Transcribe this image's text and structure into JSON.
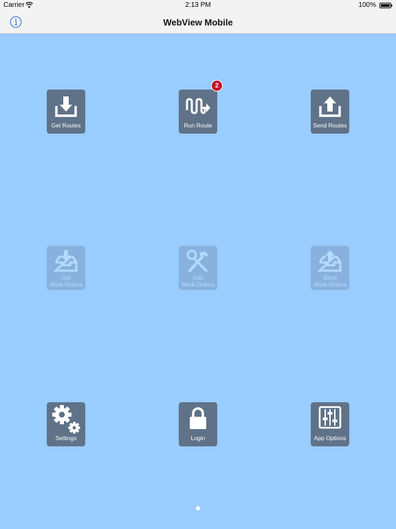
{
  "status_bar": {
    "carrier": "Carrier",
    "time": "2:13 PM",
    "battery": "100%"
  },
  "nav_bar": {
    "title": "WebView Mobile",
    "info_icon": "info-circle-icon"
  },
  "tiles": [
    {
      "id": "get-routes",
      "label": "Get Routes",
      "icon": "download-tray-icon",
      "enabled": true
    },
    {
      "id": "run-route",
      "label": "Run Route",
      "icon": "route-arrow-icon",
      "enabled": true,
      "badge": "2"
    },
    {
      "id": "send-routes",
      "label": "Send Routes",
      "icon": "upload-tray-icon",
      "enabled": true
    },
    {
      "id": "get-work-orders",
      "label": "Get\nWork Orders",
      "label_line1": "Get",
      "label_line2": "Work Orders",
      "icon": "inbox-download-icon",
      "enabled": false
    },
    {
      "id": "edit-work-orders",
      "label_line1": "Edit",
      "label_line2": "Work Orders",
      "icon": "tools-icon",
      "enabled": false
    },
    {
      "id": "send-work-orders",
      "label_line1": "Send",
      "label_line2": "Work Orders",
      "icon": "inbox-upload-icon",
      "enabled": false
    },
    {
      "id": "settings",
      "label": "Settings",
      "icon": "gears-icon",
      "enabled": true
    },
    {
      "id": "login",
      "label": "Login",
      "icon": "padlock-icon",
      "enabled": true
    },
    {
      "id": "app-options",
      "label": "App Options",
      "icon": "sliders-icon",
      "enabled": true
    }
  ],
  "colors": {
    "background": "#99ccff",
    "tile": "#5f7288",
    "badge": "#c4142a",
    "bar": "#f3f3f3"
  }
}
